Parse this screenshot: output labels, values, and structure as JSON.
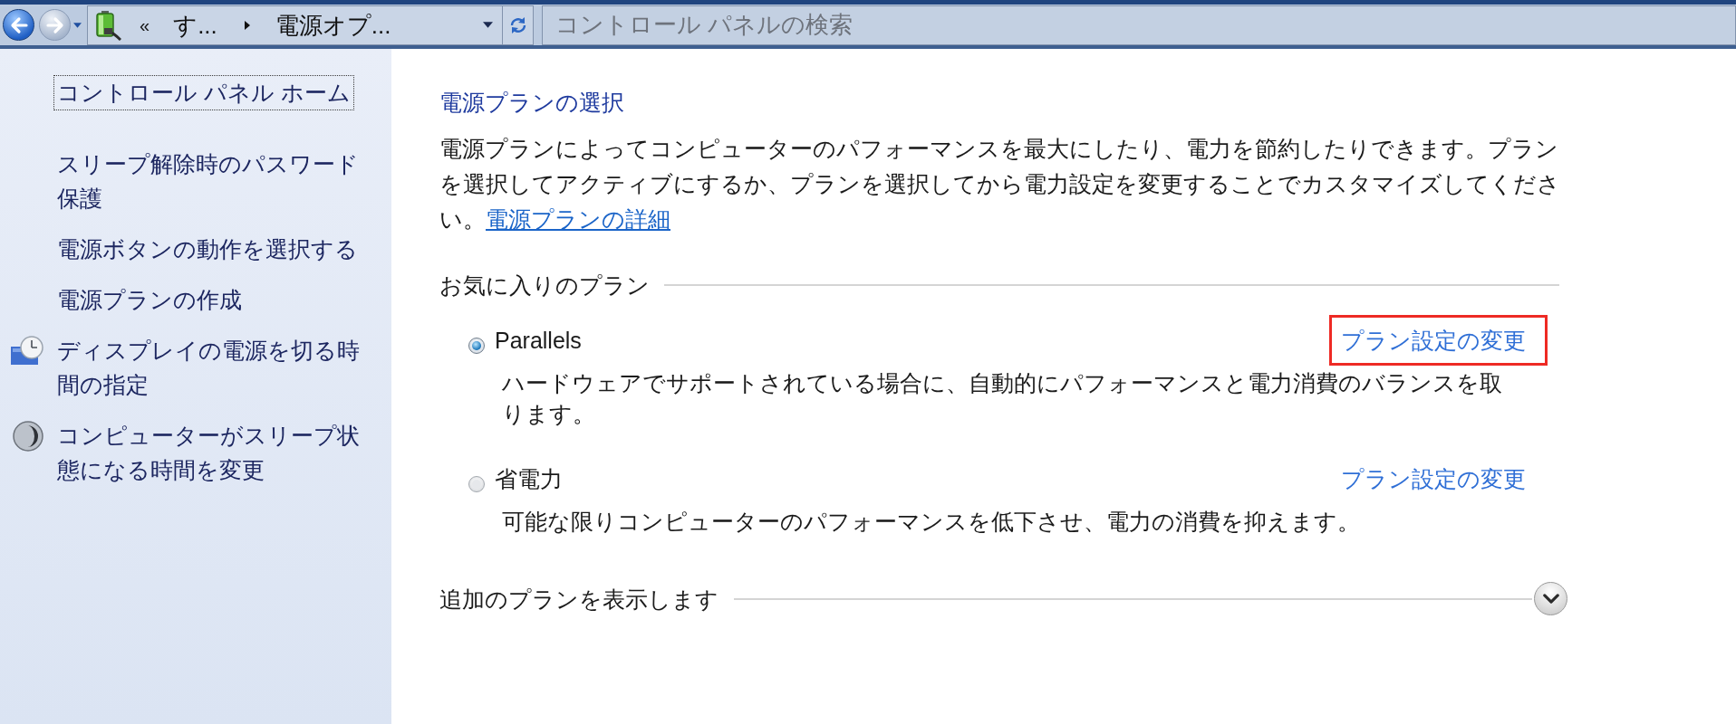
{
  "toolbar": {
    "back": {
      "disabled": false
    },
    "forward": {
      "disabled": true
    },
    "address_bar": {
      "overflow": "«",
      "crumbs": [
        "す...",
        "電源オプ..."
      ]
    },
    "search": {
      "placeholder": "コントロール パネルの検索"
    }
  },
  "sidebar": {
    "home": {
      "label": "コントロール パネル ホーム",
      "focused": true
    },
    "items": [
      {
        "label": "スリープ解除時のパスワード保護",
        "kind": "link"
      },
      {
        "label": "電源ボタンの動作を選択する",
        "kind": "link"
      },
      {
        "label": "電源プランの作成",
        "kind": "link"
      },
      {
        "label": "ディスプレイの電源を切る時間の指定",
        "kind": "display"
      },
      {
        "label": "コンピューターがスリープ状態になる時間を変更",
        "kind": "sleep"
      }
    ]
  },
  "main": {
    "title": "電源プランの選択",
    "intro": {
      "text": "電源プランによってコンピューターのパフォーマンスを最大にしたり、電力を節約したりできます。プランを選択してアクティブにするか、プランを選択してから電力設定を変更することでカスタマイズしてください。",
      "link": "電源プランの詳細"
    },
    "favorites": {
      "heading": "お気に入りのプラン",
      "plans": [
        {
          "name": "Parallels",
          "selected": true,
          "link": "プラン設定の変更",
          "highlighted": true,
          "description": "ハードウェアでサポートされている場合に、自動的にパフォーマンスと電力消費のバランスを取ります。"
        },
        {
          "name": "省電力",
          "selected": false,
          "link": "プラン設定の変更",
          "highlighted": false,
          "description": "可能な限りコンピューターのパフォーマンスを低下させ、電力の消費を抑えます。"
        }
      ]
    },
    "more_plans": {
      "label": "追加のプランを表示します",
      "expanded": false
    }
  }
}
